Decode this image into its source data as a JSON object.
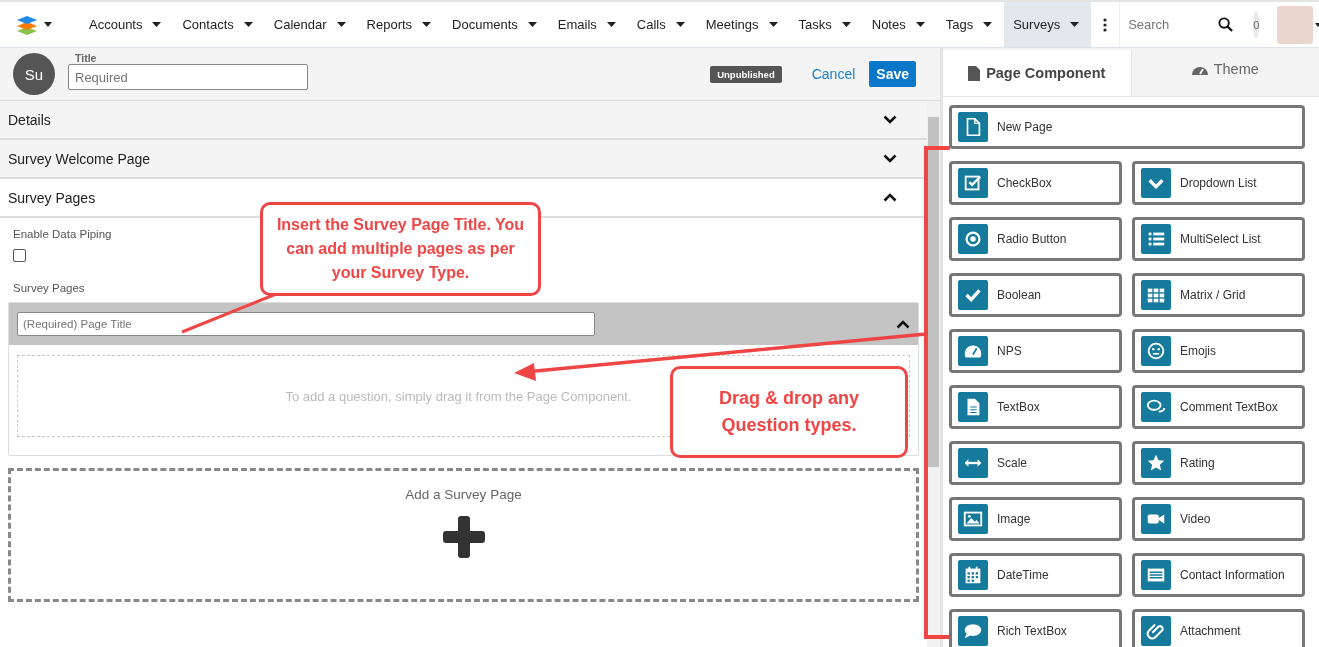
{
  "nav": {
    "items": [
      {
        "label": "Accounts",
        "selected": false
      },
      {
        "label": "Contacts",
        "selected": false
      },
      {
        "label": "Calendar",
        "selected": false
      },
      {
        "label": "Reports",
        "selected": false
      },
      {
        "label": "Documents",
        "selected": false
      },
      {
        "label": "Emails",
        "selected": false
      },
      {
        "label": "Calls",
        "selected": false
      },
      {
        "label": "Meetings",
        "selected": false
      },
      {
        "label": "Tasks",
        "selected": false
      },
      {
        "label": "Notes",
        "selected": false
      },
      {
        "label": "Tags",
        "selected": false
      },
      {
        "label": "Surveys",
        "selected": true
      }
    ],
    "search": {
      "placeholder": "Search"
    },
    "notification_count": "0"
  },
  "header": {
    "avatar": "Su",
    "title_label": "Title",
    "title_placeholder": "Required",
    "status": "Unpublished",
    "cancel": "Cancel",
    "save": "Save"
  },
  "sections": [
    {
      "title": "Details",
      "expanded": false
    },
    {
      "title": "Survey Welcome Page",
      "expanded": false
    },
    {
      "title": "Survey Pages",
      "expanded": true
    }
  ],
  "survey_pages": {
    "piping_label": "Enable Data Piping",
    "piping_checked": false,
    "pages_label": "Survey Pages",
    "page": {
      "placeholder": "(Required) Page Title",
      "expanded": true,
      "drop_hint": "To add a question, simply drag it from the Page Component."
    },
    "add_label": "Add a Survey Page"
  },
  "panel": {
    "tabs": [
      {
        "label": "Page Component",
        "selected": true
      },
      {
        "label": "Theme",
        "selected": false
      }
    ],
    "components": [
      {
        "label": "New Page",
        "kind": "page"
      },
      {
        "label": "CheckBox",
        "kind": "checkbox"
      },
      {
        "label": "Dropdown List",
        "kind": "dropdown"
      },
      {
        "label": "Radio Button",
        "kind": "radio"
      },
      {
        "label": "MultiSelect List",
        "kind": "multiselect"
      },
      {
        "label": "Boolean",
        "kind": "boolean"
      },
      {
        "label": "Matrix / Grid",
        "kind": "matrix"
      },
      {
        "label": "NPS",
        "kind": "nps"
      },
      {
        "label": "Emojis",
        "kind": "emoji"
      },
      {
        "label": "TextBox",
        "kind": "textbox"
      },
      {
        "label": "Comment TextBox",
        "kind": "comment"
      },
      {
        "label": "Scale",
        "kind": "scale"
      },
      {
        "label": "Rating",
        "kind": "rating"
      },
      {
        "label": "Image",
        "kind": "image"
      },
      {
        "label": "Video",
        "kind": "video"
      },
      {
        "label": "DateTime",
        "kind": "datetime"
      },
      {
        "label": "Contact Information",
        "kind": "contact"
      },
      {
        "label": "Rich TextBox",
        "kind": "richtext"
      },
      {
        "label": "Attachment",
        "kind": "attachment"
      }
    ]
  },
  "annotations": [
    {
      "text": "Insert the Survey Page Title. You can add multiple pages as per your Survey Type.",
      "kind": "title"
    },
    {
      "text": "Drag & drop any Question types.",
      "kind": "drag"
    }
  ]
}
